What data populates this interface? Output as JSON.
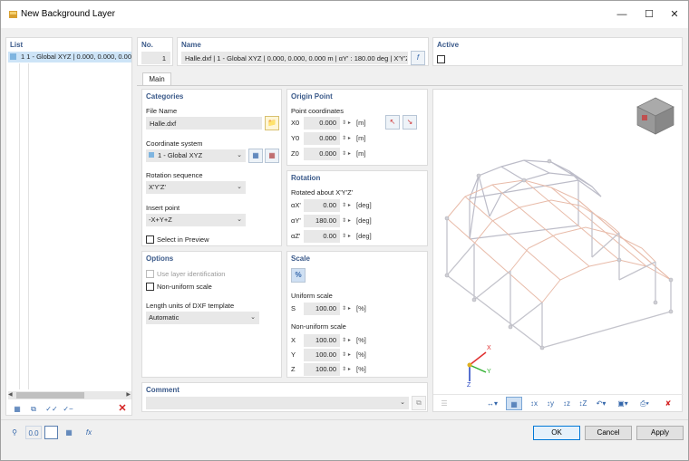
{
  "window": {
    "title": "New Background Layer"
  },
  "list": {
    "header": "List",
    "items": [
      {
        "label": "1  1 - Global XYZ | 0.000, 0.000, 0.000 m"
      }
    ]
  },
  "no": {
    "header": "No.",
    "value": "1"
  },
  "name": {
    "header": "Name",
    "value": "Halle.dxf | 1 - Global XYZ | 0.000, 0.000, 0.000 m | αY' : 180.00 deg | X'Y'Z'"
  },
  "active": {
    "header": "Active"
  },
  "tabs": {
    "main": "Main"
  },
  "categories": {
    "header": "Categories",
    "file_name_label": "File Name",
    "file_name_value": "Halle.dxf",
    "coord_label": "Coordinate system",
    "coord_value": "1 - Global XYZ",
    "rotation_seq_label": "Rotation sequence",
    "rotation_seq_value": "X'Y'Z'",
    "insert_point_label": "Insert point",
    "insert_point_value": "-X+Y+Z",
    "select_preview_label": "Select in Preview"
  },
  "origin": {
    "header": "Origin Point",
    "point_coords_label": "Point coordinates",
    "rows": [
      {
        "axis": "X0",
        "value": "0.000",
        "unit": "[m]"
      },
      {
        "axis": "Y0",
        "value": "0.000",
        "unit": "[m]"
      },
      {
        "axis": "Z0",
        "value": "0.000",
        "unit": "[m]"
      }
    ]
  },
  "rotation": {
    "header": "Rotation",
    "rotated_label": "Rotated about X'Y'Z'",
    "rows": [
      {
        "axis": "αX'",
        "value": "0.00",
        "unit": "[deg]"
      },
      {
        "axis": "αY'",
        "value": "180.00",
        "unit": "[deg]"
      },
      {
        "axis": "αZ'",
        "value": "0.00",
        "unit": "[deg]"
      }
    ]
  },
  "options": {
    "header": "Options",
    "use_layer_label": "Use layer identification",
    "non_uniform_label": "Non-uniform scale",
    "length_units_label": "Length units of DXF template",
    "length_units_value": "Automatic"
  },
  "scale": {
    "header": "Scale",
    "uniform_label": "Uniform scale",
    "uniform_row": {
      "axis": "S",
      "value": "100.00",
      "unit": "[%]"
    },
    "non_uniform_label": "Non-uniform scale",
    "rows": [
      {
        "axis": "X",
        "value": "100.00",
        "unit": "[%]"
      },
      {
        "axis": "Y",
        "value": "100.00",
        "unit": "[%]"
      },
      {
        "axis": "Z",
        "value": "100.00",
        "unit": "[%]"
      }
    ]
  },
  "comment": {
    "header": "Comment"
  },
  "axes": {
    "x": "X",
    "y": "Y",
    "z": "Z"
  },
  "buttons": {
    "ok": "OK",
    "cancel": "Cancel",
    "apply": "Apply"
  },
  "colors": {
    "accent": "#0078d7",
    "header_text": "#3b5a8a",
    "frame_front": "#e8b8a8",
    "frame_back": "#b8b8c8"
  }
}
